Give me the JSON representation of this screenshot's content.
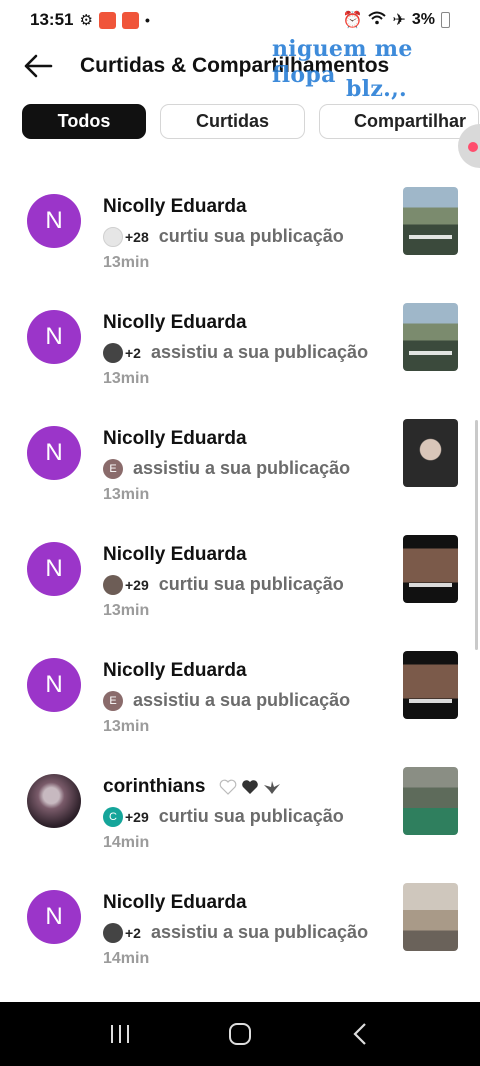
{
  "status_bar": {
    "time": "13:51",
    "battery": "3%"
  },
  "header": {
    "title": "Curtidas & Compartilhamentos"
  },
  "overlay": {
    "line1": "niguem me flopa",
    "line2": "blz.,."
  },
  "tabs": [
    {
      "label": "Todos",
      "active": true
    },
    {
      "label": "Curtidas",
      "active": false
    },
    {
      "label": "Compartilhar",
      "active": false
    }
  ],
  "notifications": [
    {
      "avatar_letter": "N",
      "name": "Nicolly Eduarda",
      "mini": "",
      "count": "+28",
      "action": "curtiu sua publicação",
      "time": "13min"
    },
    {
      "avatar_letter": "N",
      "name": "Nicolly Eduarda",
      "mini": "",
      "count": "+2",
      "action": "assistiu a sua publicação",
      "time": "13min"
    },
    {
      "avatar_letter": "N",
      "name": "Nicolly Eduarda",
      "mini": "E",
      "count": "",
      "action": "assistiu a sua publicação",
      "time": "13min"
    },
    {
      "avatar_letter": "N",
      "name": "Nicolly Eduarda",
      "mini": "",
      "count": "+29",
      "action": "curtiu sua publicação",
      "time": "13min"
    },
    {
      "avatar_letter": "N",
      "name": "Nicolly Eduarda",
      "mini": "E",
      "count": "",
      "action": "assistiu a sua publicação",
      "time": "13min"
    },
    {
      "avatar_letter": "",
      "name": "corinthians",
      "mini": "C",
      "count": "+29",
      "action": "curtiu sua publicação",
      "time": "14min"
    },
    {
      "avatar_letter": "N",
      "name": "Nicolly Eduarda",
      "mini": "",
      "count": "+2",
      "action": "assistiu a sua publicação",
      "time": "14min"
    }
  ],
  "colors": {
    "avatar_purple": "#9b35c9",
    "accent_overlay": "#2a7fd6",
    "active_tab_bg": "#111111"
  }
}
